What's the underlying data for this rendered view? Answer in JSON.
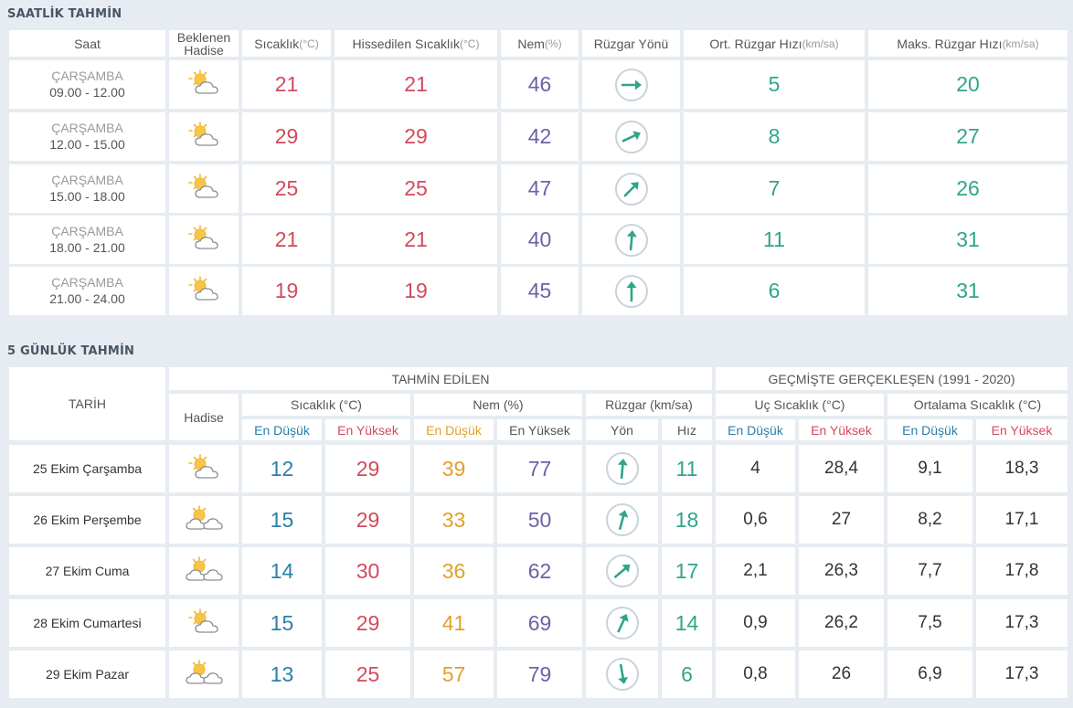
{
  "hourly": {
    "title": "SAATLİK TAHMİN",
    "headers": {
      "saat": "Saat",
      "hadise": "Beklenen Hadise",
      "sicaklik": "Sıcaklık",
      "sicaklik_unit": "(°C)",
      "hissedilen": "Hissedilen Sıcaklık",
      "hissedilen_unit": "(°C)",
      "nem": "Nem",
      "nem_unit": "(%)",
      "ruzgar_yonu": "Rüzgar Yönü",
      "ort_ruzgar": "Ort. Rüzgar Hızı",
      "ort_ruzgar_unit": "(km/sa)",
      "maks_ruzgar": "Maks. Rüzgar Hızı",
      "maks_ruzgar_unit": "(km/sa)"
    },
    "rows": [
      {
        "day": "ÇARŞAMBA",
        "range": "09.00 - 12.00",
        "icon": "partly-cloudy-icon",
        "temp": "21",
        "feels": "21",
        "humidity": "46",
        "wind_dir_deg": 90,
        "avg_wind": "5",
        "max_wind": "20"
      },
      {
        "day": "ÇARŞAMBA",
        "range": "12.00 - 15.00",
        "icon": "partly-cloudy-icon",
        "temp": "29",
        "feels": "29",
        "humidity": "42",
        "wind_dir_deg": 65,
        "avg_wind": "8",
        "max_wind": "27"
      },
      {
        "day": "ÇARŞAMBA",
        "range": "15.00 - 18.00",
        "icon": "partly-cloudy-icon",
        "temp": "25",
        "feels": "25",
        "humidity": "47",
        "wind_dir_deg": 45,
        "avg_wind": "7",
        "max_wind": "26"
      },
      {
        "day": "ÇARŞAMBA",
        "range": "18.00 - 21.00",
        "icon": "partly-cloudy-icon",
        "temp": "21",
        "feels": "21",
        "humidity": "40",
        "wind_dir_deg": 5,
        "avg_wind": "11",
        "max_wind": "31"
      },
      {
        "day": "ÇARŞAMBA",
        "range": "21.00 - 24.00",
        "icon": "partly-cloudy-icon",
        "temp": "19",
        "feels": "19",
        "humidity": "45",
        "wind_dir_deg": 0,
        "avg_wind": "6",
        "max_wind": "31"
      }
    ]
  },
  "daily": {
    "title": "5 GÜNLÜK TAHMİN",
    "headers": {
      "tarih": "TARİH",
      "tahmin_edilen": "TAHMİN EDİLEN",
      "gecmiste": "GEÇMİŞTE GERÇEKLEŞEN (1991 - 2020)",
      "hadise": "Hadise",
      "sicaklik": "Sıcaklık (°C)",
      "nem": "Nem (%)",
      "ruzgar": "Rüzgar (km/sa)",
      "uc_sicaklik": "Uç Sıcaklık (°C)",
      "ort_sicaklik": "Ortalama Sıcaklık (°C)",
      "en_dusuk": "En Düşük",
      "en_yuksek": "En Yüksek",
      "yon": "Yön",
      "hiz": "Hız"
    },
    "rows": [
      {
        "date": "25 Ekim Çarşamba",
        "icon": "partly-cloudy-icon",
        "tmin": "12",
        "tmax": "29",
        "hmin": "39",
        "hmax": "77",
        "wind_dir_deg": 5,
        "wind_speed": "11",
        "ext_min": "4",
        "ext_max": "28,4",
        "avg_min": "9,1",
        "avg_max": "18,3"
      },
      {
        "date": "26 Ekim Perşembe",
        "icon": "sun-clouds-icon",
        "tmin": "15",
        "tmax": "29",
        "hmin": "33",
        "hmax": "50",
        "wind_dir_deg": 15,
        "wind_speed": "18",
        "ext_min": "0,6",
        "ext_max": "27",
        "avg_min": "8,2",
        "avg_max": "17,1"
      },
      {
        "date": "27 Ekim Cuma",
        "icon": "sun-clouds-icon",
        "tmin": "14",
        "tmax": "30",
        "hmin": "36",
        "hmax": "62",
        "wind_dir_deg": 50,
        "wind_speed": "17",
        "ext_min": "2,1",
        "ext_max": "26,3",
        "avg_min": "7,7",
        "avg_max": "17,8"
      },
      {
        "date": "28 Ekim Cumartesi",
        "icon": "partly-cloudy-icon",
        "tmin": "15",
        "tmax": "29",
        "hmin": "41",
        "hmax": "69",
        "wind_dir_deg": 25,
        "wind_speed": "14",
        "ext_min": "0,9",
        "ext_max": "26,2",
        "avg_min": "7,5",
        "avg_max": "17,3"
      },
      {
        "date": "29 Ekim Pazar",
        "icon": "sun-clouds-icon",
        "tmin": "13",
        "tmax": "25",
        "hmin": "57",
        "hmax": "79",
        "wind_dir_deg": 170,
        "wind_speed": "6",
        "ext_min": "0,8",
        "ext_max": "26",
        "avg_min": "6,9",
        "avg_max": "17,3"
      }
    ]
  },
  "colors": {
    "temp": "#d24a5c",
    "humidity": "#6b63a6",
    "wind": "#2fa58a",
    "low_temp": "#2a7fa8",
    "low_humidity": "#e0a02c"
  }
}
